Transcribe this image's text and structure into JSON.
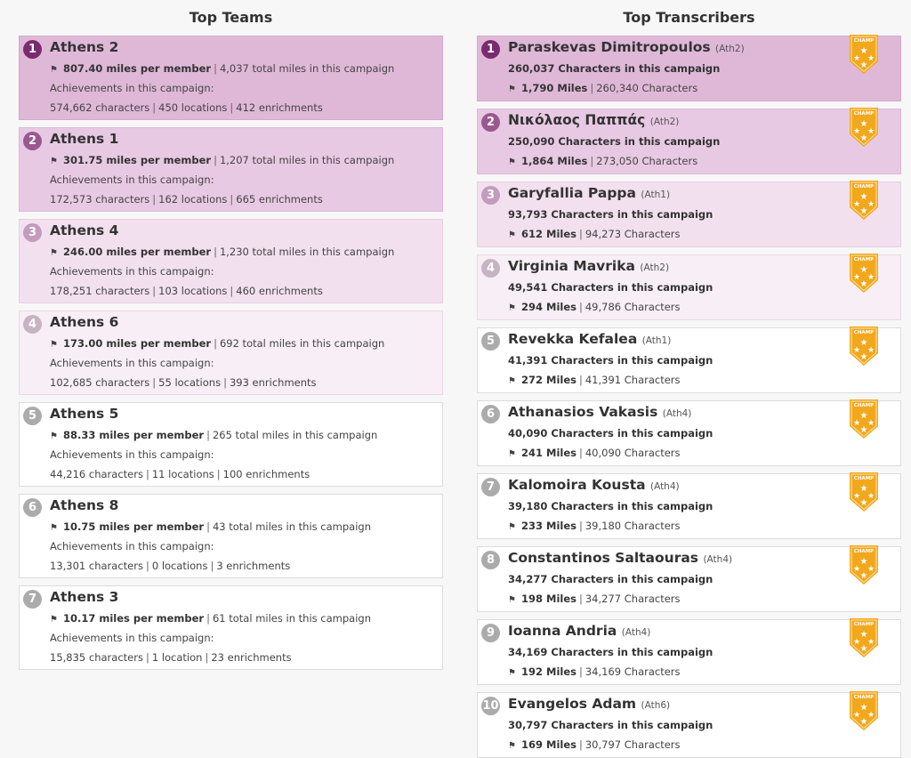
{
  "top_teams": {
    "title": "Top Teams",
    "teams": [
      {
        "rank": "1",
        "name": "Athens 2",
        "miles_per_member": "807.40 miles per member",
        "total_miles": "4,037 total miles in this campaign",
        "achievements_label": "Achievements in this campaign:",
        "characters": "574,662 characters",
        "locations": "450 locations",
        "enrichments": "412 enrichments"
      },
      {
        "rank": "2",
        "name": "Athens 1",
        "miles_per_member": "301.75 miles per member",
        "total_miles": "1,207 total miles in this campaign",
        "achievements_label": "Achievements in this campaign:",
        "characters": "172,573 characters",
        "locations": "162 locations",
        "enrichments": "665 enrichments"
      },
      {
        "rank": "3",
        "name": "Athens 4",
        "miles_per_member": "246.00 miles per member",
        "total_miles": "1,230 total miles in this campaign",
        "achievements_label": "Achievements in this campaign:",
        "characters": "178,251 characters",
        "locations": "103 locations",
        "enrichments": "460 enrichments"
      },
      {
        "rank": "4",
        "name": "Athens 6",
        "miles_per_member": "173.00 miles per member",
        "total_miles": "692 total miles in this campaign",
        "achievements_label": "Achievements in this campaign:",
        "characters": "102,685 characters",
        "locations": "55 locations",
        "enrichments": "393 enrichments"
      },
      {
        "rank": "5",
        "name": "Athens 5",
        "miles_per_member": "88.33 miles per member",
        "total_miles": "265 total miles in this campaign",
        "achievements_label": "Achievements in this campaign:",
        "characters": "44,216 characters",
        "locations": "11 locations",
        "enrichments": "100 enrichments"
      },
      {
        "rank": "6",
        "name": "Athens 8",
        "miles_per_member": "10.75 miles per member",
        "total_miles": "43 total miles in this campaign",
        "achievements_label": "Achievements in this campaign:",
        "characters": "13,301 characters",
        "locations": "0 locations",
        "enrichments": "3 enrichments"
      },
      {
        "rank": "7",
        "name": "Athens 3",
        "miles_per_member": "10.17 miles per member",
        "total_miles": "61 total miles in this campaign",
        "achievements_label": "Achievements in this campaign:",
        "characters": "15,835 characters",
        "locations": "1 location",
        "enrichments": "23 enrichments"
      }
    ]
  },
  "top_transcribers": {
    "title": "Top Transcribers",
    "badge_label": "CHAMP",
    "transcribers": [
      {
        "rank": "1",
        "name": "Paraskevas Dimitropoulos",
        "team": "(Ath2)",
        "campaign_chars": "260,037 Characters in this campaign",
        "miles": "1,790 Miles",
        "total_chars": "260,340 Characters"
      },
      {
        "rank": "2",
        "name": "Νικόλαος Παππάς",
        "team": "(Ath2)",
        "campaign_chars": "250,090 Characters in this campaign",
        "miles": "1,864 Miles",
        "total_chars": "273,050 Characters"
      },
      {
        "rank": "3",
        "name": "Garyfallia Pappa",
        "team": "(Ath1)",
        "campaign_chars": "93,793 Characters in this campaign",
        "miles": "612 Miles",
        "total_chars": "94,273 Characters"
      },
      {
        "rank": "4",
        "name": "Virginia Mavrika",
        "team": "(Ath2)",
        "campaign_chars": "49,541 Characters in this campaign",
        "miles": "294 Miles",
        "total_chars": "49,786 Characters"
      },
      {
        "rank": "5",
        "name": "Revekka Kefalea",
        "team": "(Ath1)",
        "campaign_chars": "41,391 Characters in this campaign",
        "miles": "272 Miles",
        "total_chars": "41,391 Characters"
      },
      {
        "rank": "6",
        "name": "Athanasios Vakasis",
        "team": "(Ath4)",
        "campaign_chars": "40,090 Characters in this campaign",
        "miles": "241 Miles",
        "total_chars": "40,090 Characters"
      },
      {
        "rank": "7",
        "name": "Kalomoira Kousta",
        "team": "(Ath4)",
        "campaign_chars": "39,180 Characters in this campaign",
        "miles": "233 Miles",
        "total_chars": "39,180 Characters"
      },
      {
        "rank": "8",
        "name": "Constantinos Saltaouras",
        "team": "(Ath4)",
        "campaign_chars": "34,277 Characters in this campaign",
        "miles": "198 Miles",
        "total_chars": "34,277 Characters"
      },
      {
        "rank": "9",
        "name": "Ioanna Andria",
        "team": "(Ath4)",
        "campaign_chars": "34,169 Characters in this campaign",
        "miles": "192 Miles",
        "total_chars": "34,169 Characters"
      },
      {
        "rank": "10",
        "name": "Evangelos Adam",
        "team": "(Ath6)",
        "campaign_chars": "30,797 Characters in this campaign",
        "miles": "169 Miles",
        "total_chars": "30,797 Characters"
      }
    ]
  },
  "colors": {
    "badge": "#f2a81d",
    "rank_1": "#7a2a6e",
    "row_1": "#dfb8d8"
  },
  "icons": {
    "flag": "flag-icon",
    "badge": "champ-badge-icon"
  }
}
